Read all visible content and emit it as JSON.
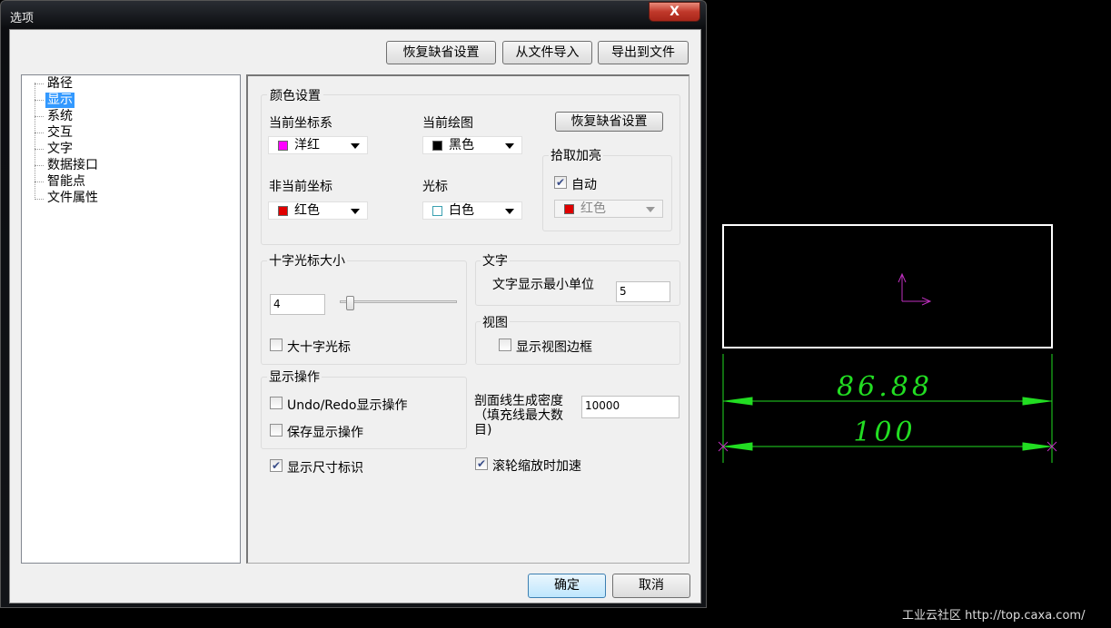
{
  "window": {
    "title": "选项",
    "close": "X"
  },
  "toolbar": {
    "restore": "恢复缺省设置",
    "import": "从文件导入",
    "export": "导出到文件"
  },
  "tree": [
    "路径",
    "显示",
    "系统",
    "交互",
    "文字",
    "数据接口",
    "智能点",
    "文件属性"
  ],
  "color": {
    "title": "颜色设置",
    "cur_cs": "当前坐标系",
    "cur_cs_val": "洋红",
    "cur_draw": "当前绘图",
    "cur_draw_val": "黑色",
    "noncur_cs": "非当前坐标",
    "noncur_cs_val": "红色",
    "cursor": "光标",
    "cursor_val": "白色",
    "restore": "恢复缺省设置",
    "pick": "拾取加亮",
    "auto": "自动",
    "pick_val": "红色",
    "colors": {
      "magenta": "#ff00ff",
      "black": "#000000",
      "red": "#e00000",
      "white": "#ffffff"
    }
  },
  "crosshair": {
    "title": "十字光标大小",
    "value": "4",
    "slider_fraction": 0.05,
    "big": "大十字光标"
  },
  "text": {
    "title": "文字",
    "min_unit": "文字显示最小单位",
    "min_unit_val": "5"
  },
  "view": {
    "title": "视图",
    "border": "显示视图边框"
  },
  "display_ops": {
    "title": "显示操作",
    "undo": "Undo/Redo显示操作",
    "save": "保存显示操作"
  },
  "hatch": {
    "label1": "剖面线生成密度",
    "label2": "（填充线最大数",
    "label3": "目)",
    "value": "10000"
  },
  "show_dim": "显示尺寸标识",
  "wheel": "滚轮缩放时加速",
  "ok": "确定",
  "cancel": "取消",
  "canvas": {
    "dim1": "86.88",
    "dim2": "100"
  },
  "watermark": "工业云社区 http://top.caxa.com/"
}
